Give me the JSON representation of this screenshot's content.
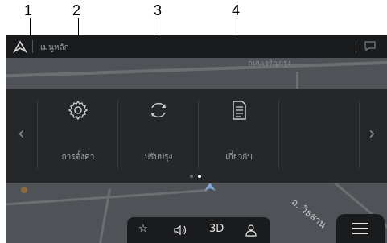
{
  "callouts": [
    "1",
    "2",
    "3",
    "4"
  ],
  "topbar": {
    "title": "เมนูหลัก",
    "nav_icon": "navigation-arrow-icon",
    "chat_icon": "chat-bubble-icon"
  },
  "map": {
    "top_label": "ถนนเจริญกรุง",
    "street_label": "ถ. วิธสาน",
    "location_icon": "current-position-icon"
  },
  "menu": {
    "items": [
      {
        "label": "การตั้งค่า",
        "icon": "gear-icon"
      },
      {
        "label": "ปรับปรุง",
        "icon": "refresh-icon"
      },
      {
        "label": "เกี่ยวกับ",
        "icon": "document-icon"
      }
    ],
    "prev_icon": "chevron-left-icon",
    "next_icon": "chevron-right-icon",
    "page_dots": {
      "count": 2,
      "active": 1
    }
  },
  "bottom": {
    "favorite_icon": "star-icon",
    "volume_icon": "speaker-icon",
    "view_mode_label": "3D",
    "user_icon": "user-icon",
    "menu_icon": "hamburger-menu-icon"
  }
}
